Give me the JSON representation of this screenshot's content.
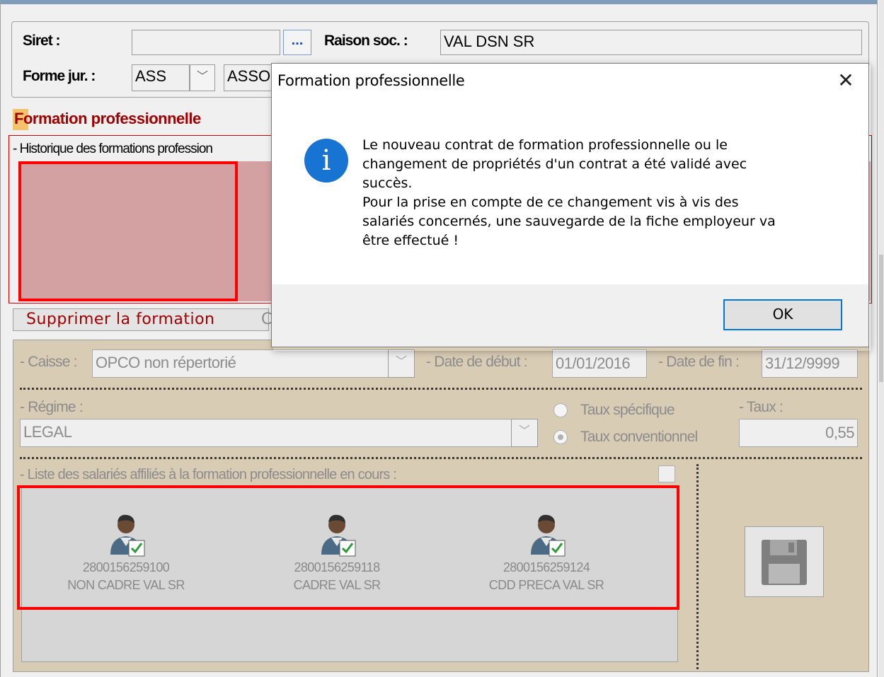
{
  "header": {
    "siret_label": "Siret :",
    "siret_value": "",
    "lookup_button": "...",
    "raison_label": "Raison soc. :",
    "raison_value": "VAL DSN SR",
    "forme_label": "Forme jur. :",
    "forme_code": "ASS",
    "forme_text": "ASSO"
  },
  "section": {
    "title": "Formation professionnelle",
    "history_label": "- Historique des formations profession",
    "delete_button": "Supprimer la formation",
    "delete_trailing": "C"
  },
  "detail": {
    "caisse_label": "- Caisse :",
    "caisse_value": "OPCO non répertorié",
    "date_debut_label": "- Date de début :",
    "date_debut_value": "01/01/2016",
    "date_fin_label": "- Date de fin :",
    "date_fin_value": "31/12/9999",
    "regime_label": "- Régime :",
    "regime_value": "LEGAL",
    "taux_specifique_label": "Taux spécifique",
    "taux_conventionnel_label": "Taux conventionnel",
    "taux_label": "- Taux :",
    "taux_value": "0,55",
    "list_label": "- Liste des salariés affiliés à la formation professionnelle en cours :",
    "employees": [
      {
        "number": "2800156259100",
        "name": "NON CADRE VAL SR"
      },
      {
        "number": "2800156259118",
        "name": "CADRE  VAL SR"
      },
      {
        "number": "2800156259124",
        "name": "CDD PRECA VAL SR"
      }
    ]
  },
  "modal": {
    "title": "Formation professionnelle",
    "close": "✕",
    "icon": "i",
    "message_lines": [
      "Le nouveau contrat de formation professionnelle ou le",
      "changement de propriétés d'un contrat a été validé avec",
      "succès.",
      "Pour la prise en compte de ce changement vis à vis des",
      "salariés concernés, une sauvegarde de la fiche employeur va",
      "être effectué !"
    ],
    "ok": "OK"
  },
  "colors": {
    "accent_red": "#a00000",
    "highlight_red": "#ff0000",
    "info_blue": "#1874d2",
    "panel_beige": "#d9ccb5"
  }
}
